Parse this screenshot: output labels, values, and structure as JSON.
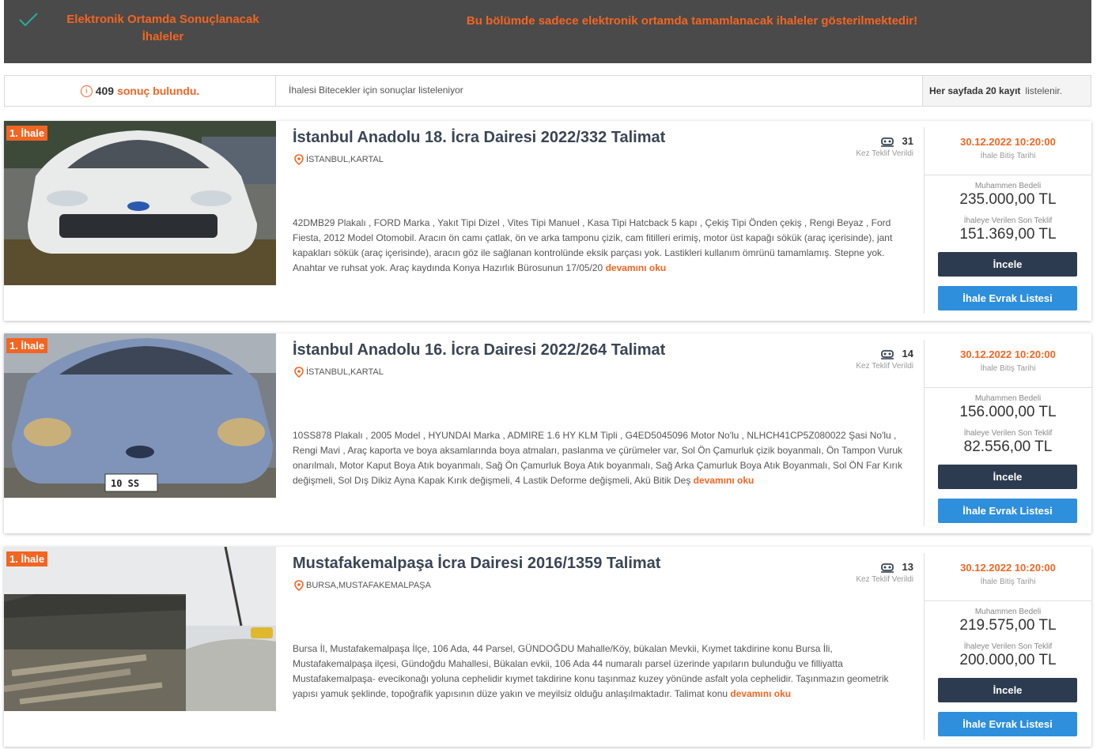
{
  "banner": {
    "title": "Elektronik Ortamda Sonuçlanacak İhaleler",
    "message": "Bu bölümde sadece elektronik ortamda tamamlanacak ihaleler gösterilmektedir!"
  },
  "results": {
    "count": "409",
    "count_suffix": "sonuç bulundu.",
    "filter_text": "İhalesi Bitecekler için sonuçlar listeleniyor",
    "per_page_bold": "Her sayfada 20 kayıt",
    "per_page_suffix": "listelenir."
  },
  "labels": {
    "bid_count": "Kez Teklif Verildi",
    "end_date": "İhale Bitiş Tarihi",
    "estimated": "Muhammen Bedeli",
    "last_bid": "İhaleye Verilen Son Teklif",
    "inspect_button": "İncele",
    "docs_button": "İhale Evrak Listesi",
    "read_more": "devamını oku"
  },
  "colors": {
    "accent": "#f26522",
    "dark_button": "#2c3b4f",
    "blue_button": "#2e8fdc",
    "banner_bg": "#4a4a4a"
  },
  "items": [
    {
      "tag": "1. İhale",
      "title": "İstanbul Anadolu 18. İcra Dairesi 2022/332 Talimat",
      "location": "İSTANBUL,KARTAL",
      "bids": "31",
      "end_date": "30.12.2022 10:20:00",
      "estimated": "235.000,00 TL",
      "last_bid": "151.369,00 TL",
      "description": "42DMB29 Plakalı , FORD Marka , Yakıt Tipi Dizel , Vites Tipi Manuel , Kasa Tipi Hatcback 5 kapı , Çekiş Tipi Önden çekiş , Rengi Beyaz , Ford Fiesta, 2012 Model Otomobil. Aracın ön camı çatlak, ön ve arka tamponu çizik, cam fitilleri erimiş, motor üst kapağı sökük (araç içerisinde), jant kapakları sökük (araç içerisinde), aracın göz ile sağlanan kontrolünde eksik parçası yok. Lastikleri kullanım ömrünü tamamlamış. Stepne yok. Anahtar ve ruhsat yok. Araç kaydında Konya Hazırlık Bürosunun 17/05/20",
      "image": "white-car-photo"
    },
    {
      "tag": "1. İhale",
      "title": "İstanbul Anadolu 16. İcra Dairesi 2022/264 Talimat",
      "location": "İSTANBUL,KARTAL",
      "bids": "14",
      "end_date": "30.12.2022 10:20:00",
      "estimated": "156.000,00 TL",
      "last_bid": "82.556,00 TL",
      "description": "10SS878 Plakalı , 2005 Model , HYUNDAI Marka , ADMIRE 1.6 HY KLM Tipli , G4ED5045096 Motor No'lu , NLHCH41CP5Z080022 Şasi No'lu , Rengi Mavi , Araç kaporta ve boya aksamlarında boya atmaları, paslanma ve çürümeler var, Sol Ön Çamurluk çizik boyanmalı, Ön Tampon Vuruk onarılmalı, Motor Kaput Boya Atık boyanmalı, Sağ Ön Çamurluk Boya Atık boyanmalı, Sağ Arka Çamurluk Boya Atık Boyanmalı, Sol ÖN Far Kırık değişmeli, Sol Dış Dikiz Ayna Kapak Kırık değişmeli, 4 Lastik Deforme değişmeli, Akü Bitik Deş",
      "image": "blue-car-photo"
    },
    {
      "tag": "1. İhale",
      "title": "Mustafakemalpaşa İcra Dairesi 2016/1359 Talimat",
      "location": "BURSA,MUSTAFAKEMALPAŞA",
      "bids": "13",
      "end_date": "30.12.2022 10:20:00",
      "estimated": "219.575,00 TL",
      "last_bid": "200.000,00 TL",
      "description": "Bursa İl, Mustafakemalpaşa İlçe, 106 Ada, 44 Parsel, GÜNDOĞDU Mahalle/Köy, bükalan Mevkii, Kıymet takdirine konu Bursa İli, Mustafakemalpaşa ilçesi, Gündoğdu Mahallesi, Bükalan evkii, 106 Ada 44 numaralı parsel üzerinde yapıların bulunduğu ve filliyatta Mustafakemalpaşa- evecikonağı yoluna cephelidir kıymet takdirine konu taşınmaz kuzey yönünde asfalt yola cephelidir. Taşınmazın geometrik yapısı yamuk şeklinde, topoğrafik yapısının düze yakın ve meyilsiz olduğu anlaşılmaktadır. Talimat konu",
      "image": "land-parcel-photo"
    }
  ]
}
